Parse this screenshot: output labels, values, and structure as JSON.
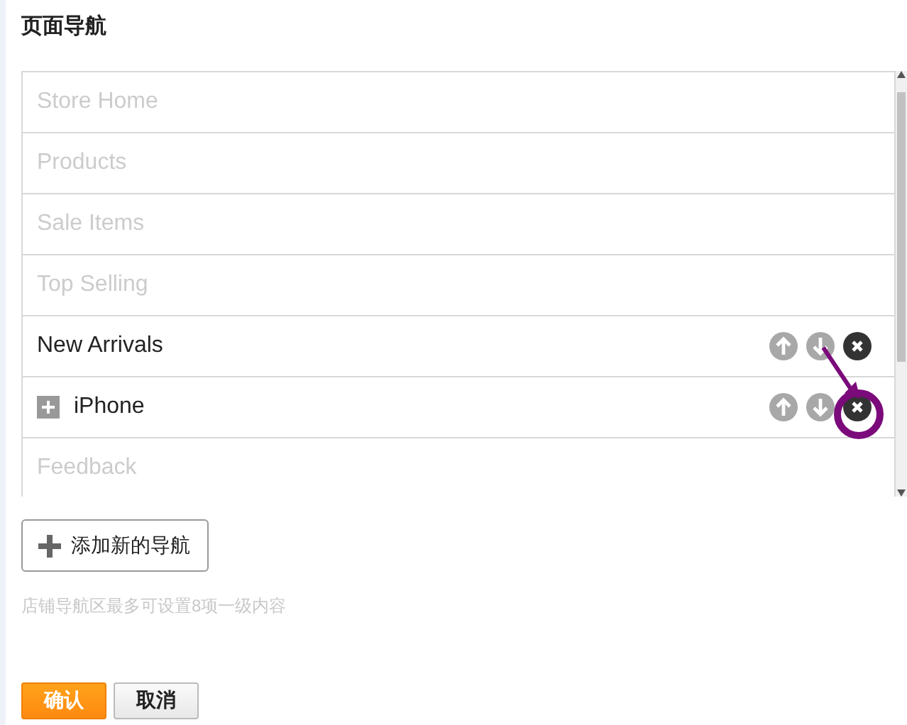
{
  "title": "页面导航",
  "nav_items": [
    {
      "label": "Store Home",
      "disabled": true,
      "expandable": false
    },
    {
      "label": "Products",
      "disabled": true,
      "expandable": false
    },
    {
      "label": "Sale Items",
      "disabled": true,
      "expandable": false
    },
    {
      "label": "Top Selling",
      "disabled": true,
      "expandable": false
    },
    {
      "label": "New Arrivals",
      "disabled": false,
      "expandable": false
    },
    {
      "label": "iPhone",
      "disabled": false,
      "expandable": true
    },
    {
      "label": "Feedback",
      "disabled": true,
      "expandable": false
    }
  ],
  "add_button": {
    "label": "添加新的导航"
  },
  "hint": "店铺导航区最多可设置8项一级内容",
  "buttons": [
    {
      "label": "确认",
      "kind": "primary"
    },
    {
      "label": "取消",
      "kind": "secondary"
    }
  ]
}
